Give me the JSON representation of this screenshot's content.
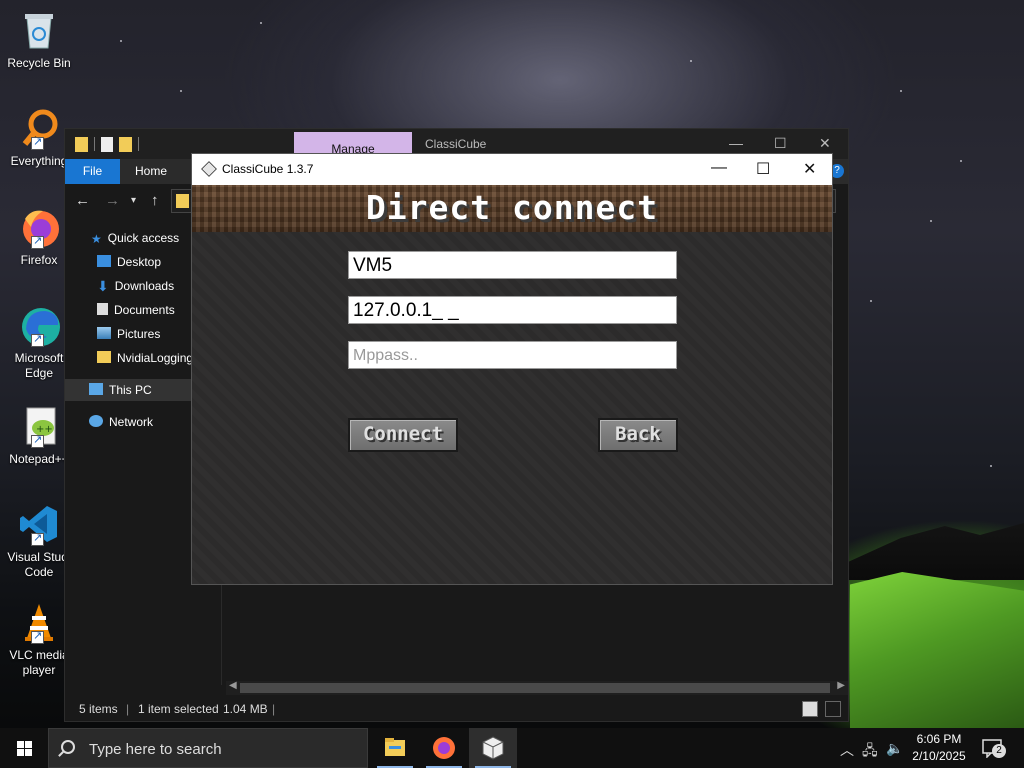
{
  "desktop": {
    "icons": [
      {
        "label": "Recycle Bin",
        "icon": "recycle-bin-icon"
      },
      {
        "label": "Everything",
        "icon": "everything-icon"
      },
      {
        "label": "Firefox",
        "icon": "firefox-icon"
      },
      {
        "label": "Microsoft Edge",
        "line1": "Microsoft",
        "line2": "Edge",
        "icon": "edge-icon"
      },
      {
        "label": "Notepad++",
        "icon": "notepadpp-icon"
      },
      {
        "label": "Visual Studio Code",
        "line1": "Visual Studi",
        "line2": "Code",
        "icon": "vscode-icon"
      },
      {
        "label": "VLC media player",
        "line1": "VLC media",
        "line2": "player",
        "icon": "vlc-icon"
      }
    ]
  },
  "explorer": {
    "title": "ClassiCube",
    "manage_tab": "Manage",
    "ribbon": {
      "file": "File",
      "home": "Home"
    },
    "nav": [
      {
        "label": "Quick access",
        "icon": "star-icon"
      },
      {
        "label": "Desktop",
        "icon": "desktop-folder-icon"
      },
      {
        "label": "Downloads",
        "icon": "downloads-icon"
      },
      {
        "label": "Documents",
        "icon": "documents-icon"
      },
      {
        "label": "Pictures",
        "icon": "pictures-icon"
      },
      {
        "label": "NvidiaLogging",
        "icon": "folder-icon"
      },
      {
        "label": "This PC",
        "icon": "pc-icon"
      },
      {
        "label": "Network",
        "icon": "network-icon"
      }
    ],
    "status": {
      "items": "5 items",
      "selected": "1 item selected",
      "size": "1.04 MB"
    }
  },
  "classicube": {
    "window_title": "ClassiCube 1.3.7",
    "heading": "Direct connect",
    "username_value": "VM5",
    "address_value": "127.0.0.1_ _",
    "mppass_placeholder": "Mppass..",
    "connect_label": "Connect",
    "back_label": "Back"
  },
  "taskbar": {
    "search_placeholder": "Type here to search",
    "apps": [
      "file-explorer-icon",
      "firefox-icon",
      "classicube-icon"
    ],
    "time": "6:06 PM",
    "date": "2/10/2025",
    "notification_count": "2"
  },
  "colors": {
    "accent_blue": "#1976d2",
    "manage_tab": "#d3b5e8",
    "folder_yellow": "#f2cc58"
  }
}
